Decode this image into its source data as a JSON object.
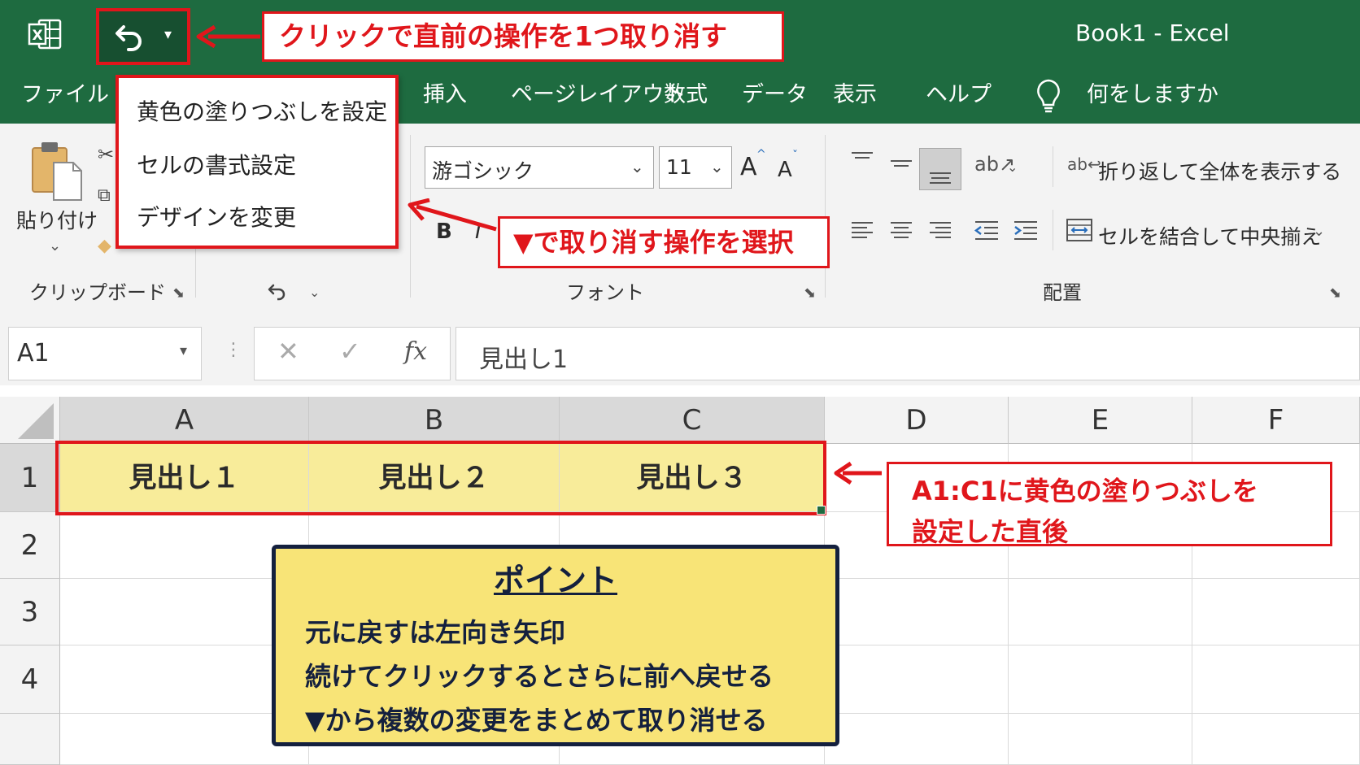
{
  "window": {
    "title": "Book1  -  Excel"
  },
  "qat": {
    "undo_tooltip_callout": "クリックで直前の操作を1つ取り消す"
  },
  "tabs": [
    {
      "label": "ファイル"
    },
    {
      "label": "挿入"
    },
    {
      "label": "ページレイアウト"
    },
    {
      "label": "数式"
    },
    {
      "label": "データ"
    },
    {
      "label": "表示"
    },
    {
      "label": "ヘルプ"
    }
  ],
  "tell_me": {
    "label": "何をしますか"
  },
  "undo_menu": {
    "items": [
      "黄色の塗りつぶしを設定",
      "セルの書式設定",
      "デザインを変更"
    ]
  },
  "undo_menu_callout": "▼で取り消す操作を選択",
  "ribbon": {
    "clipboard": {
      "paste_label": "貼り付け",
      "group_label": "クリップボード"
    },
    "font": {
      "font_name": "游ゴシック",
      "font_size": "11",
      "grow_label": "A",
      "shrink_label": "A",
      "bold": "B",
      "italic": "I",
      "group_label": "フォント"
    },
    "alignment": {
      "wrap_text": "折り返して全体を表示する",
      "merge_center": "セルを結合して中央揃え",
      "group_label": "配置"
    }
  },
  "formula_bar": {
    "name_box": "A1",
    "fx": "fx",
    "formula": "見出し1"
  },
  "grid": {
    "columns": [
      "A",
      "B",
      "C",
      "D",
      "E",
      "F"
    ],
    "rows": [
      "1",
      "2",
      "3",
      "4"
    ],
    "cells": {
      "A1": "見出し１",
      "B1": "見出し２",
      "C1": "見出し３"
    }
  },
  "fill_callout": {
    "line1": "A1:C1に黄色の塗りつぶしを",
    "line2": "設定した直後"
  },
  "point_box": {
    "title": "ポイント",
    "lines": [
      "元に戻すは左向き矢印",
      "続けてクリックするとさらに前へ戻せる",
      "▼から複数の変更をまとめて取り消せる"
    ]
  },
  "colors": {
    "excel_green": "#1e6b40",
    "callout_red": "#e0161b",
    "fill_yellow": "#f8ec9a",
    "point_bg": "#f8e477",
    "point_border": "#14203e"
  }
}
